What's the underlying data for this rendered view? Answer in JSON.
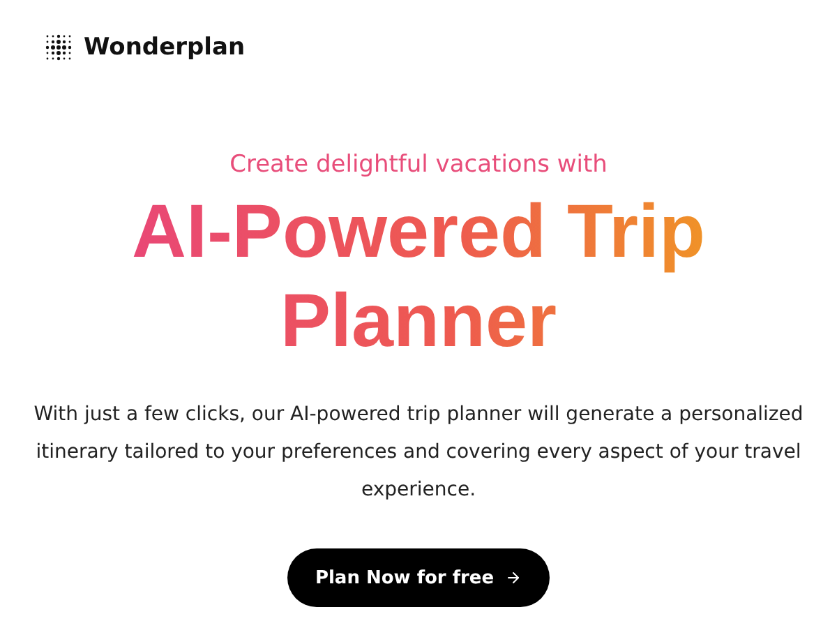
{
  "brand": {
    "name": "Wonderplan"
  },
  "hero": {
    "kicker": "Create delightful vacations with",
    "headline": "AI-Powered Trip Planner",
    "description": "With just a few clicks, our AI-powered trip planner will generate a personalized itinerary tailored to your preferences and covering every aspect of your travel experience.",
    "cta": "Plan Now for free"
  }
}
